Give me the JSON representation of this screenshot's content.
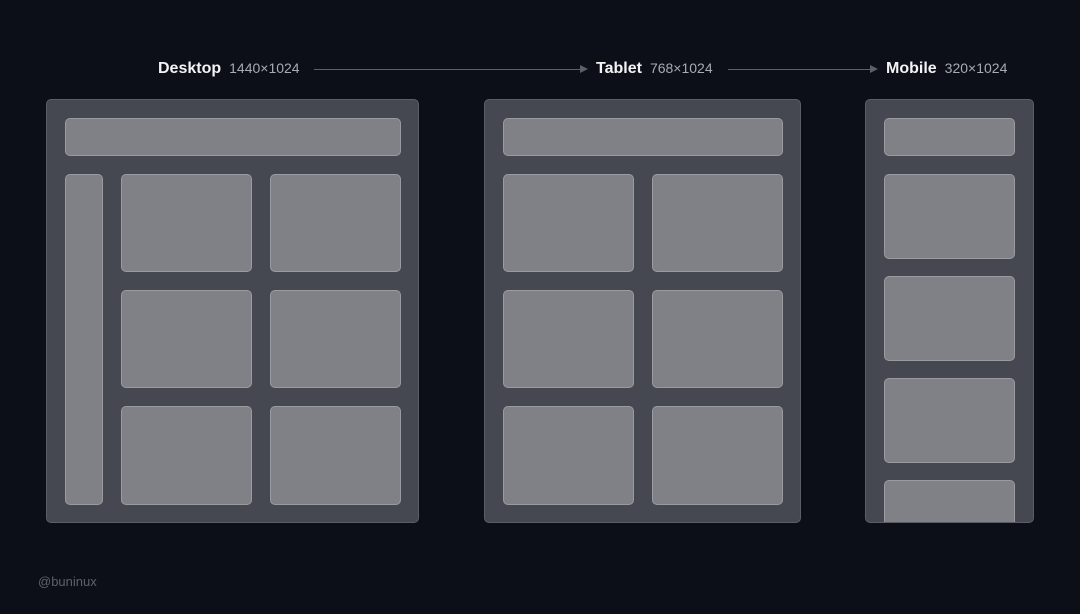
{
  "breakpoints": [
    {
      "name": "Desktop",
      "dimensions": "1440×1024"
    },
    {
      "name": "Tablet",
      "dimensions": "768×1024"
    },
    {
      "name": "Mobile",
      "dimensions": "320×1024"
    }
  ],
  "credit": "@buninux",
  "colors": {
    "background": "#0c0f17",
    "frame": "#454850",
    "block": "#808186",
    "arrow": "#5c6068"
  }
}
